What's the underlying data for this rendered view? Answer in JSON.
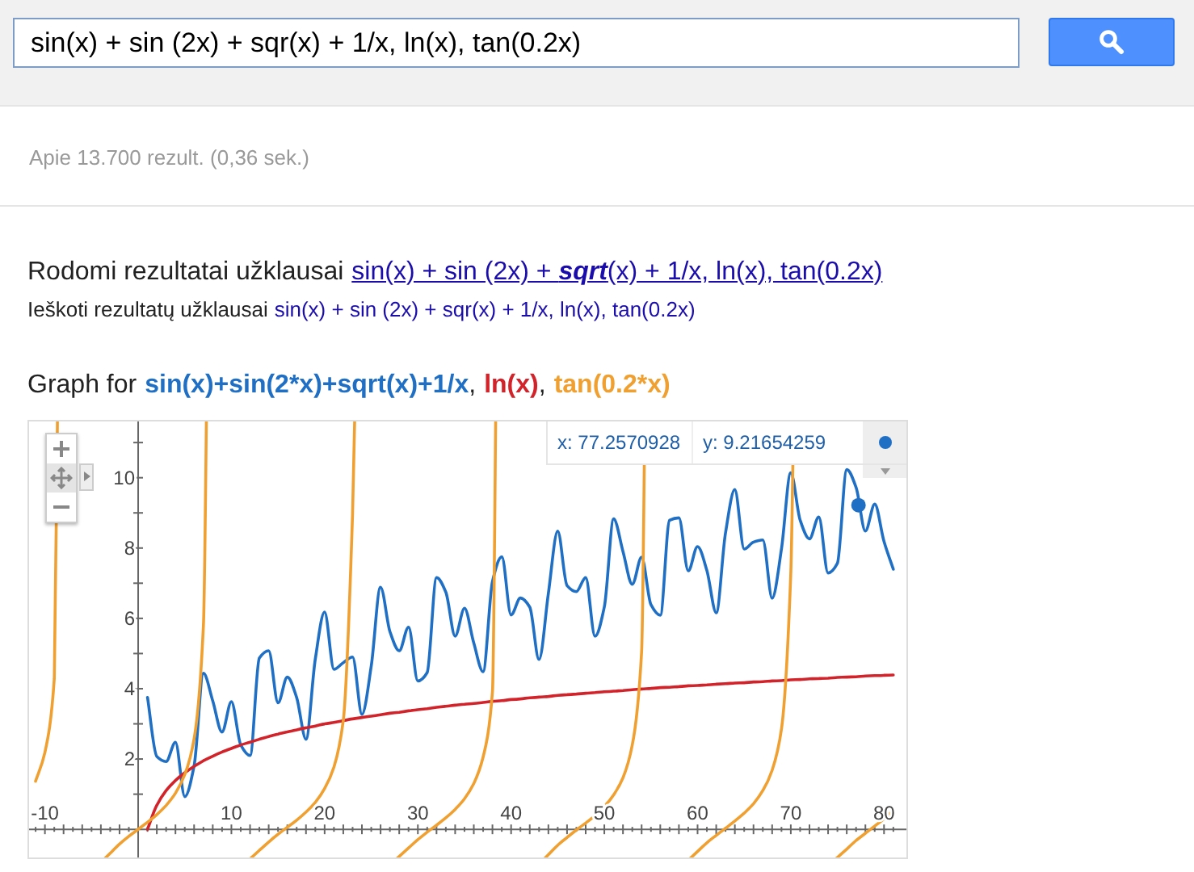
{
  "search": {
    "value": "sin(x) + sin (2x) + sqr(x) + 1/x, ln(x), tan(0.2x)"
  },
  "result_stats": "Apie 13.700 rezult. (0,36 sek.)",
  "spelling": {
    "showing_label": "Rodomi rezultatai užklausai",
    "showing_query": "sin(x) + sin (2x) + **sqrt**(x) + 1/x, ln(x), tan(0.2x)",
    "search_instead_label": "Ieškoti rezultatų užklausai",
    "search_instead_query": "sin(x) + sin (2x) + sqr(x) + 1/x, ln(x), tan(0.2x)"
  },
  "graph": {
    "prefix": "Graph for",
    "separator": ",",
    "chart_data": {
      "type": "line",
      "xlim": [
        -11.7,
        82.4
      ],
      "ylim": [
        -0.8,
        11.6
      ],
      "xticks": [
        {
          "value": -10,
          "label": "-10"
        },
        {
          "value": 10,
          "label": "10"
        },
        {
          "value": 20,
          "label": "20"
        },
        {
          "value": 30,
          "label": "30"
        },
        {
          "value": 40,
          "label": "40"
        },
        {
          "value": 50,
          "label": "50"
        },
        {
          "value": 60,
          "label": "60"
        },
        {
          "value": 70,
          "label": "70"
        },
        {
          "value": 80,
          "label": "80"
        }
      ],
      "yticks": [
        {
          "value": 2,
          "label": "2"
        },
        {
          "value": 4,
          "label": "4"
        },
        {
          "value": 6,
          "label": "6"
        },
        {
          "value": 8,
          "label": "8"
        },
        {
          "value": 10,
          "label": "10"
        }
      ],
      "x": [
        -11,
        -10,
        -9,
        -8,
        -7,
        -6,
        -5,
        -4,
        -3,
        -2,
        -1,
        0,
        1,
        2,
        3,
        4,
        5,
        6,
        7,
        8,
        9,
        10,
        11,
        12,
        13,
        14,
        15,
        16,
        17,
        18,
        19,
        20,
        21,
        22,
        23,
        24,
        25,
        26,
        27,
        28,
        29,
        30,
        31,
        32,
        33,
        34,
        35,
        36,
        37,
        38,
        39,
        40,
        41,
        42,
        43,
        44,
        45,
        46,
        47,
        48,
        49,
        50,
        51,
        52,
        53,
        54,
        55,
        56,
        57,
        58,
        59,
        60,
        61,
        62,
        63,
        64,
        65,
        66,
        67,
        68,
        69,
        70,
        71,
        72,
        73,
        74,
        75,
        76,
        77,
        78,
        79,
        80,
        81
      ],
      "series": [
        {
          "name": "sin(x)+sin(2*x)+sqrt(x)+1/x",
          "color": "#1f6fc5",
          "values": [
            null,
            null,
            null,
            null,
            null,
            null,
            null,
            null,
            null,
            null,
            null,
            null,
            3.75,
            2.07,
            1.93,
            2.48,
            0.93,
            1.8,
            4.44,
            3.65,
            2.77,
            3.63,
            2.4,
            2.1,
            4.87,
            5.08,
            3.6,
            4.33,
            3.75,
            2.56,
            4.86,
            6.18,
            4.55,
            4.74,
            4.9,
            3.27,
            4.65,
            6.89,
            5.63,
            5.08,
            5.75,
            4.22,
            4.46,
            7.16,
            6.75,
            5.49,
            6.29,
            5.29,
            4.48,
            7.05,
            7.75,
            6.1,
            6.58,
            6.32,
            4.83,
            6.71,
            8.48,
            6.93,
            6.76,
            7.16,
            5.49,
            6.32,
            8.83,
            7.9,
            6.97,
            7.74,
            6.39,
            6.09,
            8.79,
            8.86,
            7.35,
            8.04,
            7.36,
            6.16,
            8.45,
            9.66,
            7.97,
            8.17,
            8.23,
            6.57,
            7.98,
            10.14,
            8.8,
            8.26,
            8.88,
            7.29,
            7.57,
            10.23,
            9.73,
            8.48,
            9.25,
            8.18,
            7.4
          ]
        },
        {
          "name": "ln(x)",
          "color": "#d2232a",
          "values": [
            null,
            null,
            null,
            null,
            null,
            null,
            null,
            null,
            null,
            null,
            null,
            null,
            0,
            0.69,
            1.1,
            1.39,
            1.61,
            1.79,
            1.95,
            2.08,
            2.2,
            2.3,
            2.4,
            2.48,
            2.56,
            2.64,
            2.71,
            2.77,
            2.83,
            2.89,
            2.94,
            3.0,
            3.04,
            3.09,
            3.14,
            3.18,
            3.22,
            3.26,
            3.3,
            3.33,
            3.37,
            3.4,
            3.43,
            3.47,
            3.5,
            3.53,
            3.56,
            3.58,
            3.61,
            3.64,
            3.66,
            3.69,
            3.71,
            3.74,
            3.76,
            3.78,
            3.81,
            3.83,
            3.85,
            3.87,
            3.89,
            3.91,
            3.93,
            3.95,
            3.97,
            3.99,
            4.01,
            4.03,
            4.04,
            4.06,
            4.08,
            4.09,
            4.11,
            4.13,
            4.14,
            4.16,
            4.17,
            4.19,
            4.2,
            4.22,
            4.23,
            4.25,
            4.26,
            4.28,
            4.29,
            4.3,
            4.32,
            4.33,
            4.34,
            4.36,
            4.37,
            4.38,
            4.39
          ]
        },
        {
          "name": "tan(0.2*x)",
          "color": "#f0a030",
          "values": [
            1.37,
            2.19,
            4.29,
            null,
            null,
            null,
            null,
            null,
            -0.68,
            -0.42,
            -0.2,
            0,
            0.2,
            0.42,
            0.68,
            1.03,
            1.56,
            2.57,
            5.8,
            null,
            null,
            null,
            null,
            null,
            -0.6,
            -0.36,
            -0.14,
            0.06,
            0.26,
            0.49,
            0.77,
            1.16,
            1.77,
            3.11,
            8.95,
            null,
            null,
            null,
            null,
            null,
            -0.53,
            -0.29,
            -0.08,
            0.12,
            0.33,
            0.57,
            0.87,
            1.31,
            2.05,
            3.92,
            null,
            null,
            null,
            null,
            null,
            -0.72,
            -0.45,
            -0.23,
            -0.02,
            0.18,
            0.39,
            0.65,
            0.98,
            1.47,
            2.39,
            5.04,
            null,
            null,
            null,
            null,
            null,
            -0.63,
            -0.38,
            -0.17,
            0.03,
            0.24,
            0.46,
            0.73,
            1.1,
            1.68,
            2.86,
            7.22,
            null,
            null,
            null,
            null,
            null,
            -0.56,
            -0.32,
            -0.11,
            0.09,
            0.3,
            0.54
          ]
        }
      ],
      "annotations": [
        "x: 77.2570928",
        "y: 9.21654259"
      ]
    }
  }
}
